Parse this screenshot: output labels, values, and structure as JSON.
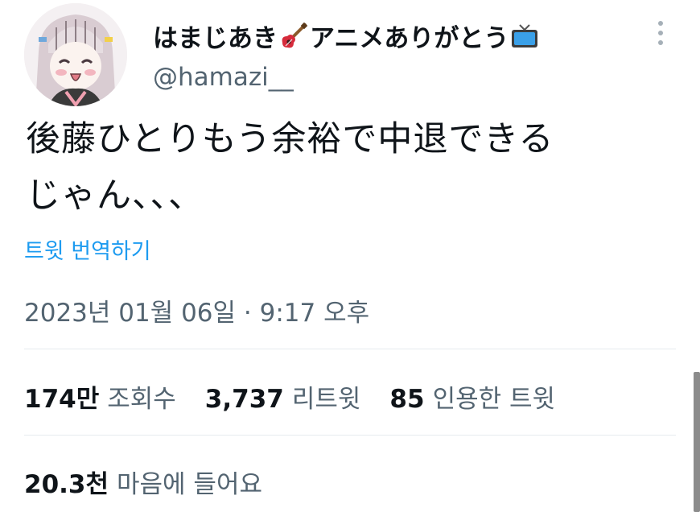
{
  "header": {
    "display_name": "はまじあき🎸アニメありがとう📺",
    "display_name_text": "はまじあき",
    "display_name_text_2": "アニメありがとう",
    "emoji_1": "guitar-icon",
    "emoji_2": "tv-icon",
    "handle": "@hamazi__"
  },
  "tweet": {
    "line_1": "後藤ひとりもう余裕で中退できる",
    "line_2": "じゃん、、、",
    "translate_label": "트윗 번역하기",
    "timestamp": "2023년 01월 06일 · 9:17 오후"
  },
  "stats": {
    "views_value": "174만",
    "views_label": "조회수",
    "retweets_value": "3,737",
    "retweets_label": "리트윗",
    "quotes_value": "85",
    "quotes_label": "인용한 트윗",
    "likes_value": "20.3천",
    "likes_label": "마음에 들어요"
  },
  "colors": {
    "link": "#1d9bf0",
    "secondary_text": "#536471",
    "primary_text": "#0f1419"
  }
}
